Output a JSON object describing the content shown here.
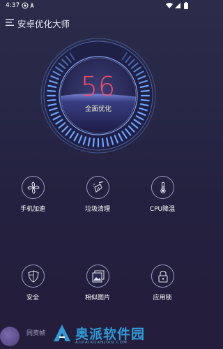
{
  "status_bar": {
    "time": "4:37"
  },
  "app_bar": {
    "title": "安卓优化大师"
  },
  "gauge": {
    "score": "56",
    "label": "全面优化",
    "level": 0.56
  },
  "features_row1": [
    {
      "label": "手机加速",
      "icon": "fan-icon"
    },
    {
      "label": "垃圾清理",
      "icon": "broom-icon"
    },
    {
      "label": "CPU降温",
      "icon": "thermometer-icon"
    }
  ],
  "features_row2": [
    {
      "label": "安全",
      "icon": "shield-icon"
    },
    {
      "label": "相似图片",
      "icon": "image-icon"
    },
    {
      "label": "应用锁",
      "icon": "lock-icon"
    }
  ],
  "bottom": {
    "partial_text": "同资帧"
  },
  "watermark": {
    "name": "奥派软件园",
    "url": "AOPAIRUANJIAN.COM"
  },
  "colors": {
    "background": "#262545",
    "score": "#ff4a66",
    "gauge_ticks": "#6fa6ff",
    "watermark": "#2f9bd8"
  }
}
